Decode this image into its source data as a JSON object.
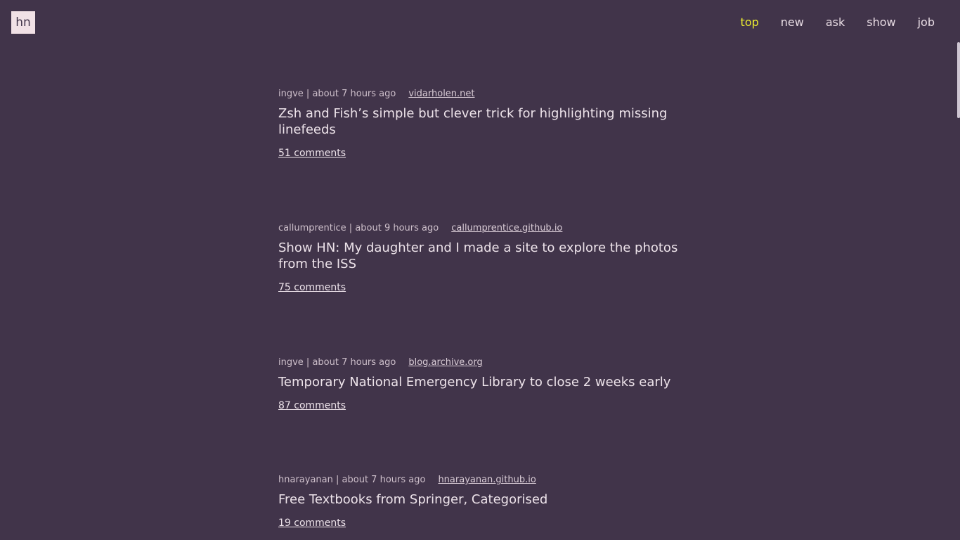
{
  "header": {
    "logo_text": "hn",
    "nav": [
      {
        "label": "top",
        "active": true
      },
      {
        "label": "new",
        "active": false
      },
      {
        "label": "ask",
        "active": false
      },
      {
        "label": "show",
        "active": false
      },
      {
        "label": "job",
        "active": false
      }
    ],
    "active_color": "#ecec30",
    "background_color": "#41344a"
  },
  "stories": [
    {
      "author": "ingve",
      "time": "about 7 hours ago",
      "domain": "vidarholen.net",
      "title": "Zsh and Fish’s simple but clever trick for highlighting missing linefeeds",
      "comments": "51 comments"
    },
    {
      "author": "callumprentice",
      "time": "about 9 hours ago",
      "domain": "callumprentice.github.io",
      "title": "Show HN: My daughter and I made a site to explore the photos from the ISS",
      "comments": "75 comments"
    },
    {
      "author": "ingve",
      "time": "about 7 hours ago",
      "domain": "blog.archive.org",
      "title": "Temporary National Emergency Library to close 2 weeks early",
      "comments": "87 comments"
    },
    {
      "author": "hnarayanan",
      "time": "about 7 hours ago",
      "domain": "hnarayanan.github.io",
      "title": "Free Textbooks from Springer, Categorised",
      "comments": "19 comments"
    }
  ]
}
